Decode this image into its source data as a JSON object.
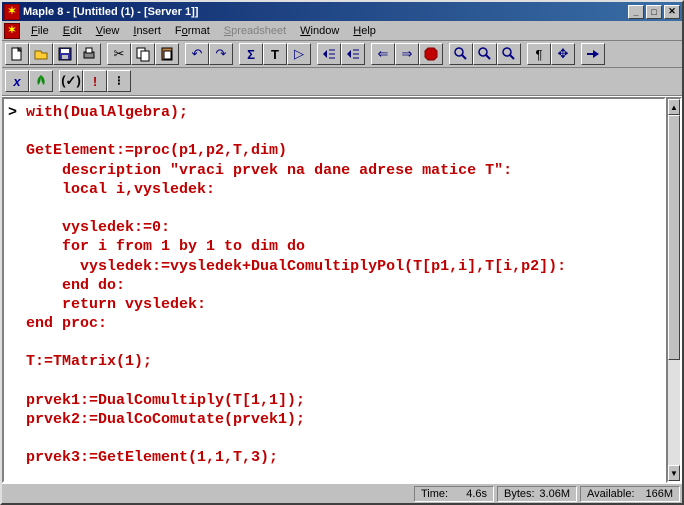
{
  "title": "Maple 8  - [Untitled (1) - [Server 1]]",
  "menus": {
    "file": "File",
    "edit": "Edit",
    "view": "View",
    "insert": "Insert",
    "format": "Format",
    "spreadsheet": "Spreadsheet",
    "window": "Window",
    "help": "Help"
  },
  "status": {
    "time_label": "Time:",
    "time_value": "4.6s",
    "bytes_label": "Bytes:",
    "bytes_value": "3.06M",
    "avail_label": "Available:",
    "avail_value": "166M"
  },
  "tool": {
    "new": "new",
    "open": "open",
    "save": "save",
    "print": "print",
    "cut": "cut",
    "copy": "copy",
    "paste": "paste",
    "undo": "undo",
    "redo": "redo",
    "sigma": "sum",
    "text": "text",
    "group": "paragraph",
    "indent": "indent",
    "outdent": "outdent",
    "back": "back",
    "forward": "forward",
    "stop": "stop",
    "zoomin": "zoom-in",
    "zoomout": "zoom-out",
    "zoomfull": "zoom-full",
    "nonprint": "pilcrow",
    "resize": "resize",
    "run": "run",
    "x": "x",
    "leaf": "leaf",
    "paren": "paren",
    "bang": "bang",
    "colon": "colon"
  },
  "code": {
    "l1": "with(DualAlgebra);",
    "l2": "",
    "l3": "GetElement:=proc(p1,p2,T,dim)",
    "l4": "    description \"vraci prvek na dane adrese matice T\":",
    "l5": "    local i,vysledek:",
    "l6": "",
    "l7": "    vysledek:=0:",
    "l8": "    for i from 1 by 1 to dim do",
    "l9": "      vysledek:=vysledek+DualComultiplyPol(T[p1,i],T[i,p2]):",
    "l10": "    end do:",
    "l11": "    return vysledek:",
    "l12": "end proc:",
    "l13": "",
    "l14": "T:=TMatrix(1);",
    "l15": "",
    "l16": "prvek1:=DualComultiply(T[1,1]);",
    "l17": "prvek2:=DualCoComutate(prvek1);",
    "l18": "",
    "l19": "prvek3:=GetElement(1,1,T,3);"
  }
}
